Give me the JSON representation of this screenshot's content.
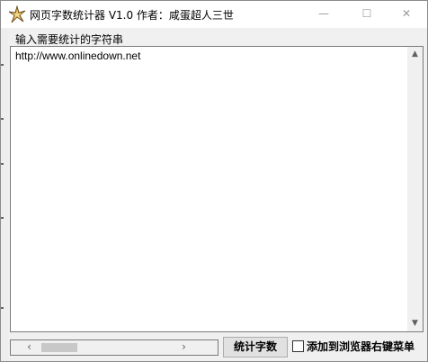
{
  "window": {
    "title": "网页字数统计器 V1.0 作者：咸蛋超人三世",
    "minimize_symbol": "—",
    "maximize_symbol": "☐",
    "close_symbol": "✕"
  },
  "input_group": {
    "label": "输入需要统计的字符串",
    "value": "http://www.onlinedown.net"
  },
  "scrollbars": {
    "vertical_up": "▲",
    "vertical_down": "▼",
    "horizontal_left": "‹",
    "horizontal_right": "›"
  },
  "actions": {
    "count_button_label": "统计字数",
    "checkbox_label": "添加到浏览器右键菜单",
    "checkbox_checked": false
  },
  "colors": {
    "title_bg": "#ffffff",
    "window_bg": "#f0f0f0",
    "button_bg": "#e1e1e1"
  },
  "icons": {
    "app": "star-burst-icon"
  }
}
